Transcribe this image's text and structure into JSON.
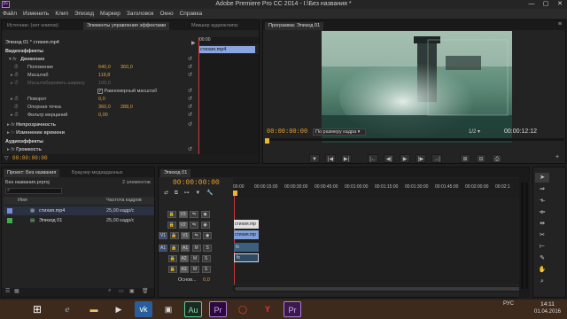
{
  "app": {
    "title": "Adobe Premiere Pro CC 2014 - I:\\Без названия *",
    "logo": "Pr",
    "win_controls": [
      "—",
      "▢",
      "✕"
    ]
  },
  "menu": [
    "Файл",
    "Изменить",
    "Клип",
    "Эпизод",
    "Маркер",
    "Заголовок",
    "Окно",
    "Справка"
  ],
  "effects_panel": {
    "tabs": [
      "Источник: (нет клипов)",
      "Элементы управления эффектами",
      "Микшер аудиоклипа:"
    ],
    "clip_path": "Эпизод 01 * стиxия.mp4",
    "ruler_time": "00:00",
    "clip_bar_label": "стиxия.mp4",
    "video_effects_label": "Видеоэффекты",
    "motion_label": "Движение",
    "position": {
      "label": "Положение",
      "x": "640,0",
      "y": "360,0"
    },
    "scale": {
      "label": "Масштаб",
      "value": "118,8"
    },
    "scale_width": {
      "label": "Масштабировать ширину",
      "value": "100,0"
    },
    "uniform_scale": "Равномерный масштаб",
    "rotation": {
      "label": "Поворот",
      "value": "0,0"
    },
    "anchor": {
      "label": "Опорная точка",
      "x": "360,0",
      "y": "288,0"
    },
    "flicker": {
      "label": "Фильтр мерцаний",
      "value": "0,00"
    },
    "opacity_label": "Непрозрачность",
    "time_remap_label": "Изменение времени",
    "audio_effects_label": "Аудиоэффекты",
    "volume_label": "Громкость",
    "timecode": "00:00:00:00"
  },
  "program": {
    "tab": "Программа: Эпизод 01",
    "timecode": "00:00:00:00",
    "fit_label": "По размеру кадра",
    "resolution": "1/2",
    "duration": "00:00:12:12",
    "controls": [
      "▼",
      "|◀",
      "▶|",
      "|←",
      "◀|",
      "▶",
      "|▶",
      "→|",
      "⊞",
      "⊟",
      "⎙"
    ]
  },
  "project": {
    "tabs": [
      "Проект: Без названия",
      "Браузер медиаданных"
    ],
    "file": "Без названия.prproj",
    "count": "2 элементов",
    "columns": [
      "Имя",
      "Частота кадров"
    ],
    "items": [
      {
        "name": "стиxия.mp4",
        "fps": "25,00 кадр/с",
        "color": "#7c8be0"
      },
      {
        "name": "Эпизод 01",
        "fps": "25,00 кадр/с",
        "color": "#3fae49"
      }
    ]
  },
  "timeline": {
    "tab": "Эпизод 01",
    "timecode": "00:00:00:00",
    "ruler": [
      "00:00",
      "00:00:15:00",
      "00:00:30:00",
      "00:00:45:00",
      "00:01:00:00",
      "00:01:15:00",
      "00:01:30:00",
      "00:01:45:00",
      "00:02:00:00",
      "00:02:1"
    ],
    "video_tracks": [
      "V3",
      "V2",
      "V1"
    ],
    "audio_tracks": [
      "A1",
      "A2",
      "A3"
    ],
    "src_v": "V1",
    "src_a": "A1",
    "master_label": "Основ...",
    "master_value": "0,0",
    "clip_v2": "стиxия.mp",
    "clip_v1": "стиxия.mp",
    "clip_a1": "fx",
    "clip_a2": "fx"
  },
  "taskbar": {
    "start_icon": "windows-icon",
    "time": "14:11",
    "date": "01.04.2016",
    "lang": "РУС"
  }
}
